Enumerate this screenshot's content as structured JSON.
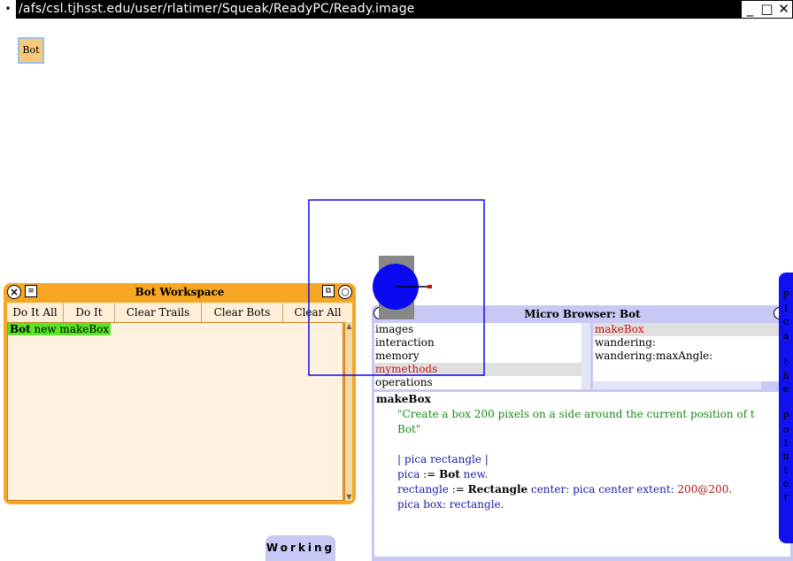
{
  "window": {
    "title": "/afs/csl.tjhsst.edu/user/rlatimer/Squeak/ReadyPC/Ready.image"
  },
  "desktop": {
    "bot_icon_label": "Bot"
  },
  "workspace": {
    "title": "Bot Workspace",
    "buttons": [
      "Do It All",
      "Do It",
      "Clear Trails",
      "Clear Bots",
      "Clear All"
    ],
    "code_bold": "Bot",
    "code_rest": " new makeBox"
  },
  "browser": {
    "title": "Micro Browser: Bot",
    "categories": [
      "images",
      "interaction",
      "memory",
      "mymethods",
      "operations"
    ],
    "selected_category": "mymethods",
    "methods": [
      "makeBox",
      "wandering:",
      "wandering:maxAngle:"
    ],
    "selected_method": "makeBox",
    "source": {
      "selector": "makeBox",
      "comment_line1": "\"Create a box 200 pixels on a side around the current position of t",
      "comment_line2": "Bot\"",
      "temps": "| pica rectangle |",
      "l1_a": "pica",
      "l1_b": " := ",
      "l1_c": "Bot",
      "l1_d": " new",
      "l2_a": "rectangle",
      "l2_b": " := ",
      "l2_c": "Rectangle",
      "l2_d": " center: ",
      "l2_e": "pica",
      "l2_f": " center extent: ",
      "l2_g": "200@200",
      "l3_a": "pica",
      "l3_b": " box: ",
      "l3_c": "rectangle"
    }
  },
  "flaps": {
    "working": "Working",
    "pica_the_pointer": "Pica the Pointer"
  },
  "colors": {
    "workspace_orange": "#f6a623",
    "browser_lavender": "#c8c8f4",
    "bot_blue": "#0a0af0",
    "selection_red": "#d01010"
  },
  "icons": [
    "close-icon",
    "menu-icon",
    "collapse-icon",
    "expand-icon",
    "scroll-up-icon",
    "scroll-down-icon",
    "scroll-left-icon",
    "scroll-right-icon"
  ]
}
